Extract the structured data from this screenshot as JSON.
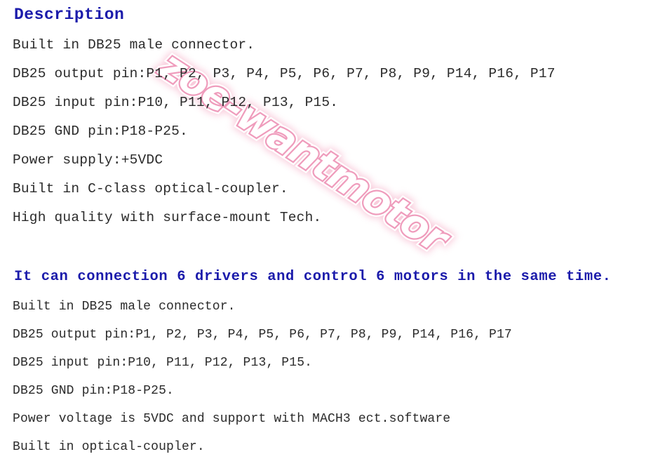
{
  "page": {
    "background_color": "#ffffff",
    "text_color": "#2b2b2b",
    "heading_color": "#1b1bab"
  },
  "watermark": {
    "text": "zoe-wantmotor",
    "stroke_color": "#ef9cbc",
    "fill_color": "#ffffff",
    "glow_color": "#f8c4d6",
    "rotation_degrees": 33
  },
  "section_top": {
    "heading": "Description",
    "lines": [
      "Built in DB25 male connector.",
      "DB25 output pin:P1, P2, P3, P4, P5, P6, P7, P8, P9, P14, P16, P17",
      "DB25 input pin:P10, P11, P12, P13, P15.",
      "DB25 GND pin:P18-P25.",
      "Power supply:+5VDC",
      "Built in C-class optical-coupler.",
      "High quality with surface-mount Tech."
    ]
  },
  "section_emphasis": {
    "heading": "It can connection 6 drivers and control 6 motors in the same time."
  },
  "section_bottom": {
    "lines": [
      "Built in DB25 male connector.",
      "DB25 output pin:P1, P2, P3, P4, P5, P6, P7, P8, P9, P14, P16, P17",
      "DB25 input pin:P10, P11, P12, P13, P15.",
      "DB25 GND pin:P18-P25.",
      "Power voltage is 5VDC and support with MACH3 ect.software",
      "Built in optical-coupler."
    ]
  }
}
